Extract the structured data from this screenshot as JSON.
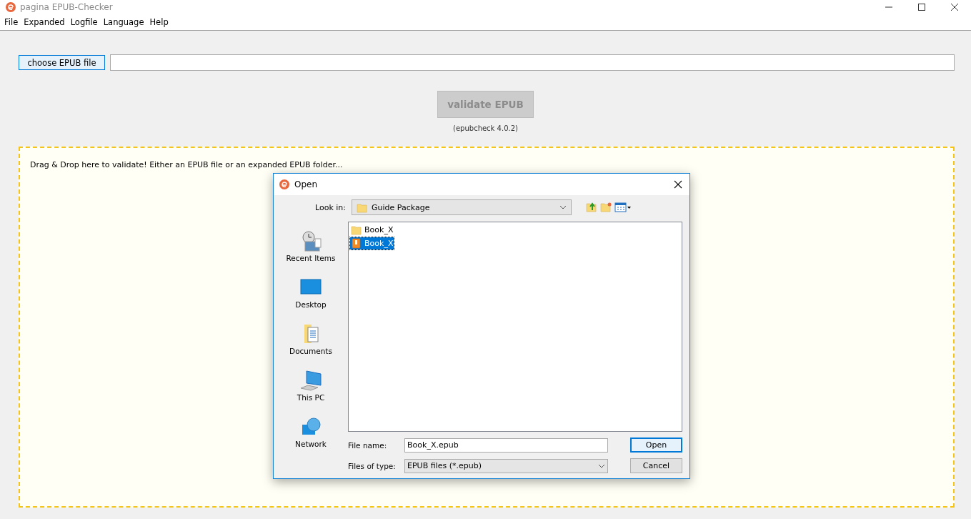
{
  "window": {
    "title": "pagina EPUB-Checker"
  },
  "menu": [
    "File",
    "Expanded",
    "Logfile",
    "Language",
    "Help"
  ],
  "choose_button": "choose EPUB file",
  "validate_button": {
    "label": "validate EPUB",
    "disabled": true
  },
  "version": "(epubcheck 4.0.2)",
  "drop_zone": {
    "text": "Drag & Drop here to validate! Either an EPUB file or an expanded EPUB folder..."
  },
  "dialog": {
    "title": "Open",
    "look_in_label": "Look in:",
    "look_in_value": "Guide Package",
    "places": [
      {
        "label": "Recent Items",
        "kind": "recent"
      },
      {
        "label": "Desktop",
        "kind": "desktop"
      },
      {
        "label": "Documents",
        "kind": "documents"
      },
      {
        "label": "This PC",
        "kind": "pc"
      },
      {
        "label": "Network",
        "kind": "network"
      }
    ],
    "files": [
      {
        "name": "Book_X",
        "kind": "folder",
        "selected": false
      },
      {
        "name": "Book_X",
        "kind": "epub",
        "selected": true
      }
    ],
    "file_name_label": "File name:",
    "file_name_value": "Book_X.epub",
    "file_type_label": "Files of type:",
    "file_type_value": "EPUB files (*.epub)",
    "buttons": [
      {
        "label": "Open",
        "default": true
      },
      {
        "label": "Cancel",
        "default": false
      }
    ]
  }
}
